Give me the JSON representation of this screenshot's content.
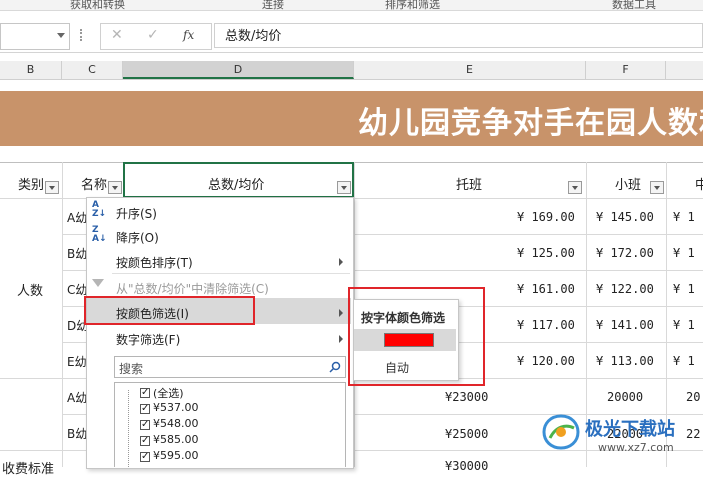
{
  "ribbon": {
    "groups": [
      "获取和转换",
      "连接",
      "排序和筛选",
      "数据工具"
    ]
  },
  "formula_bar": {
    "cancel": "✕",
    "confirm": "✓",
    "fx": "fx",
    "formula": "总数/均价"
  },
  "columns": [
    "B",
    "C",
    "D",
    "E",
    "F"
  ],
  "title": "幼儿园竞争对手在园人数和",
  "headers": {
    "category": "类别",
    "name": "名称",
    "total": "总数/均价",
    "tuoban": "托班",
    "xiaoban": "小班",
    "zhong": "中"
  },
  "row_labels": {
    "group1": "人数",
    "group2": "收费标准"
  },
  "names": [
    "A幼",
    "B幼",
    "C幼",
    "D幼",
    "E幼",
    "A幼",
    "B幼"
  ],
  "tuoban_values": [
    "¥ 169.00",
    "¥ 125.00",
    "¥ 161.00",
    "¥ 117.00",
    "¥ 120.00",
    "¥23000",
    "¥25000",
    "¥30000"
  ],
  "xiaoban_values": [
    "¥ 145.00",
    "¥ 172.00",
    "¥ 122.00",
    "¥ 141.00",
    "¥ 113.00",
    "20000",
    "22000"
  ],
  "zhong_values": [
    "¥ 1",
    "¥ 1",
    "¥ 1",
    "¥ 1",
    "¥ 1",
    "20",
    "22"
  ],
  "menu": {
    "sort_asc": "升序(S)",
    "sort_desc": "降序(O)",
    "sort_color": "按颜色排序(T)",
    "clear_filter": "从\"总数/均价\"中清除筛选(C)",
    "filter_color": "按颜色筛选(I)",
    "number_filter": "数字筛选(F)",
    "search_placeholder": "搜索",
    "checklist": [
      "(全选)",
      "¥537.00",
      "¥548.00",
      "¥585.00",
      "¥595.00"
    ]
  },
  "submenu": {
    "title": "按字体颜色筛选",
    "swatch_color": "#ff0000",
    "auto": "自动"
  },
  "watermark": {
    "name": "极光下载站",
    "url": "www.xz7.com"
  },
  "colors": {
    "banner": "#c8936a",
    "highlight": "#e0252a"
  }
}
